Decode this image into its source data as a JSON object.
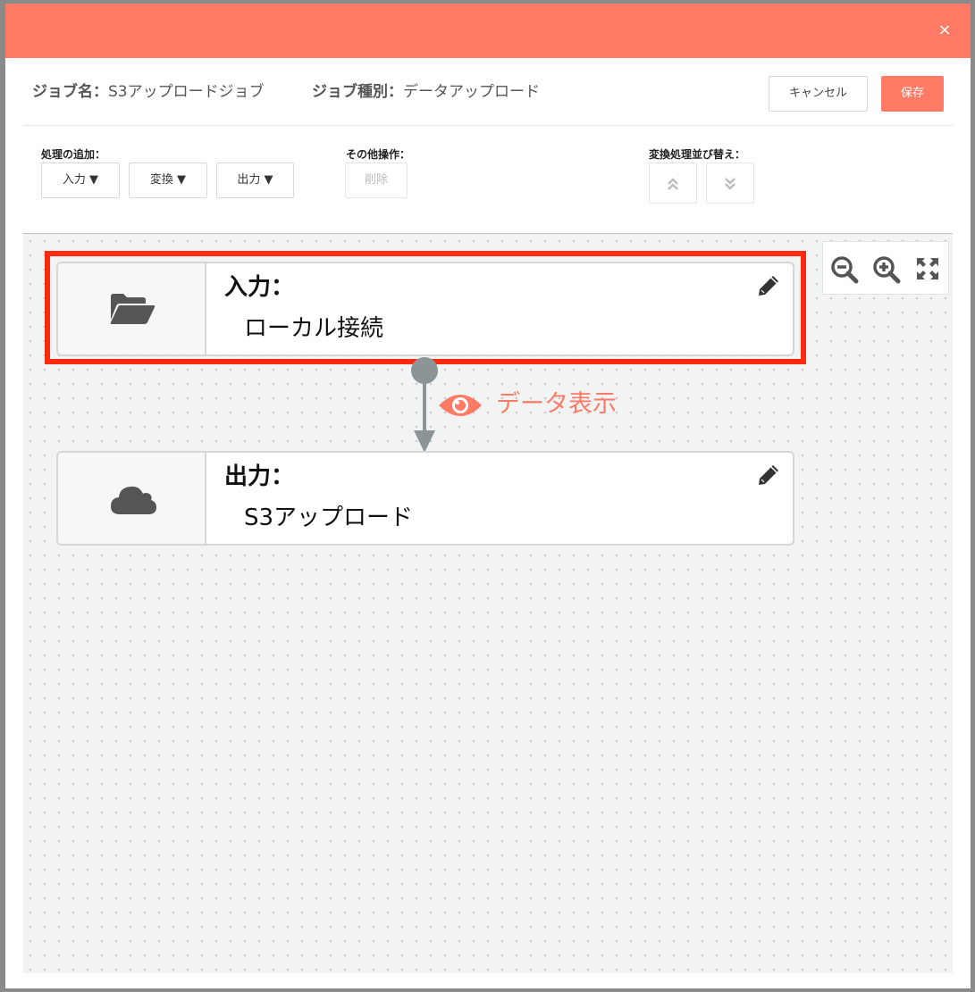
{
  "dialog": {
    "close_icon": "close-icon",
    "close_label": "×"
  },
  "job": {
    "name_label": "ジョブ名：",
    "name_value": "S3アップロードジョブ",
    "type_label": "ジョブ種別：",
    "type_value": "データアップロード"
  },
  "actions": {
    "cancel_label": "キャンセル",
    "save_label": "保存"
  },
  "toolbar": {
    "add_label": "処理の追加：",
    "input_label": "入力 ▼",
    "transform_label": "変換 ▼",
    "output_label": "出力 ▼",
    "other_label": "その他操作：",
    "delete_label": "削除",
    "reorder_label": "変換処理並び替え：",
    "move_up_glyph": "︽",
    "move_down_glyph": "︾"
  },
  "canvas": {
    "zoom_out_icon": "zoom-out-icon",
    "zoom_in_icon": "zoom-in-icon",
    "fit_icon": "fit-screen-icon",
    "nodes": [
      {
        "type_label": "入力：",
        "name": "ローカル接続",
        "icon": "folder-open-icon",
        "selected": true
      },
      {
        "type_label": "出力：",
        "name": "S3アップロード",
        "icon": "cloud-icon",
        "selected": false
      }
    ],
    "edge": {
      "data_view_label": "データ表示",
      "data_view_icon": "eye-icon"
    }
  },
  "colors": {
    "accent": "#ff7b65",
    "highlight": "#ff2a10",
    "edge": "#8b9497",
    "canvas_bg": "#f2f3f3"
  }
}
